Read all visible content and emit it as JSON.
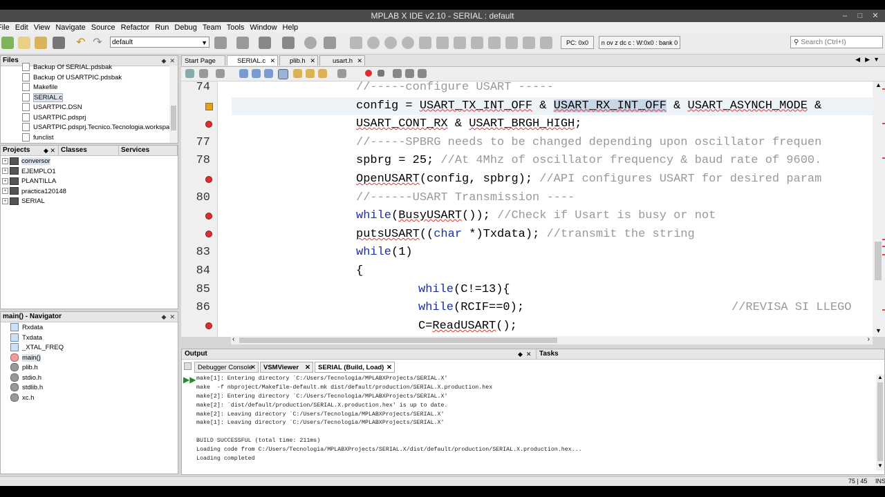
{
  "window": {
    "title": "MPLAB X IDE v2.10 - SERIAL : default"
  },
  "menu": [
    "File",
    "Edit",
    "View",
    "Navigate",
    "Source",
    "Refactor",
    "Run",
    "Debug",
    "Team",
    "Tools",
    "Window",
    "Help"
  ],
  "toolbar": {
    "configuration": "default",
    "pc": "PC: 0x0",
    "status": "n ov z dc c : W:0x0 : bank 0",
    "search_placeholder": "Search (Ctrl+I)"
  },
  "files_panel": {
    "title": "Files",
    "items": [
      "Backup Of SERIAL.pdsbak",
      "Backup Of USARTPIC.pdsbak",
      "Makefile",
      "SERIAL.c",
      "USARTPIC.DSN",
      "USARTPIC.pdsprj",
      "USARTPIC.pdsprj.Tecnico.Tecnologia.workspace",
      "funclist"
    ],
    "selected": "SERIAL.c"
  },
  "projects_panel": {
    "tabs": [
      "Projects",
      "Classes",
      "Services"
    ],
    "items": [
      "conversor",
      "EJEMPLO1",
      "PLANTILLA",
      "practica120148",
      "SERIAL"
    ]
  },
  "navigator_panel": {
    "title": "main() - Navigator",
    "items": [
      "Rxdata",
      "Txdata",
      "_XTAL_FREQ",
      "main()",
      "plib.h",
      "stdio.h",
      "stdlib.h",
      "xc.h"
    ]
  },
  "editor": {
    "tabs": [
      "Start Page",
      "SERIAL.c",
      "plib.h",
      "usart.h"
    ],
    "active_tab": "SERIAL.c",
    "line_numbers": [
      "74",
      "",
      "",
      "77",
      "78",
      "",
      "80",
      "",
      "",
      "83",
      "84",
      "85",
      "86",
      ""
    ],
    "lines": {
      "l0": "//-----configure USART -----",
      "l1a": "config = ",
      "l1b": "USART_TX_INT_OFF",
      "l1c": " & ",
      "l1d": "USART_RX_INT_OFF",
      "l1e": " & ",
      "l1f": "USART_ASYNCH_MODE",
      "l1g": " &",
      "l2a": "USART_CONT_RX",
      "l2b": " & ",
      "l2c": "USART_BRGH_HIGH",
      "l2d": ";",
      "l3": "//-----SPBRG needs to be changed depending upon oscillator frequen",
      "l4a": "spbrg = 25; ",
      "l4b": "//At 4Mhz of oscillator frequency & baud rate of 9600.",
      "l5a": "OpenUSART",
      "l5b": "(config, spbrg); ",
      "l5c": "//API configures USART for desired param",
      "l6": "//------USART Transmission ----",
      "l7a": "while",
      "l7b": "(",
      "l7c": "BusyUSART",
      "l7d": "()); ",
      "l7e": "//Check if Usart is busy or not",
      "l8a": "putsUSART",
      "l8b": "((",
      "l8c": "char",
      "l8d": " *)Txdata); ",
      "l8e": "//transmit the string",
      "l9a": "while",
      "l9b": "(1)",
      "l10": "{",
      "l11a": "while",
      "l11b": "(C!=13){",
      "l12a": "while",
      "l12b": "(RCIF==0);",
      "l12c": "//REVISA SI LLEGO",
      "l13a": "C=",
      "l13b": "ReadUSART",
      "l13c": "();"
    }
  },
  "output": {
    "title": "Output",
    "tasks_tab": "Tasks",
    "tabs": [
      "Debugger Console",
      "VSMViewer",
      "SERIAL (Build, Load)"
    ],
    "active_tab": "SERIAL (Build, Load)",
    "lines": [
      "make[1]: Entering directory `C:/Users/Tecnologia/MPLABXProjects/SERIAL.X'",
      "make  -f nbproject/Makefile-default.mk dist/default/production/SERIAL.X.production.hex",
      "make[2]: Entering directory `C:/Users/Tecnologia/MPLABXProjects/SERIAL.X'",
      "make[2]: `dist/default/production/SERIAL.X.production.hex' is up to date.",
      "make[2]: Leaving directory `C:/Users/Tecnologia/MPLABXProjects/SERIAL.X'",
      "make[1]: Leaving directory `C:/Users/Tecnologia/MPLABXProjects/SERIAL.X'",
      "",
      "BUILD SUCCESSFUL (total time: 211ms)",
      "Loading code from C:/Users/Tecnologia/MPLABXProjects/SERIAL.X/dist/default/production/SERIAL.X.production.hex...",
      "Loading completed"
    ]
  },
  "statusbar": {
    "position": "75 | 45",
    "mode": "INS"
  }
}
